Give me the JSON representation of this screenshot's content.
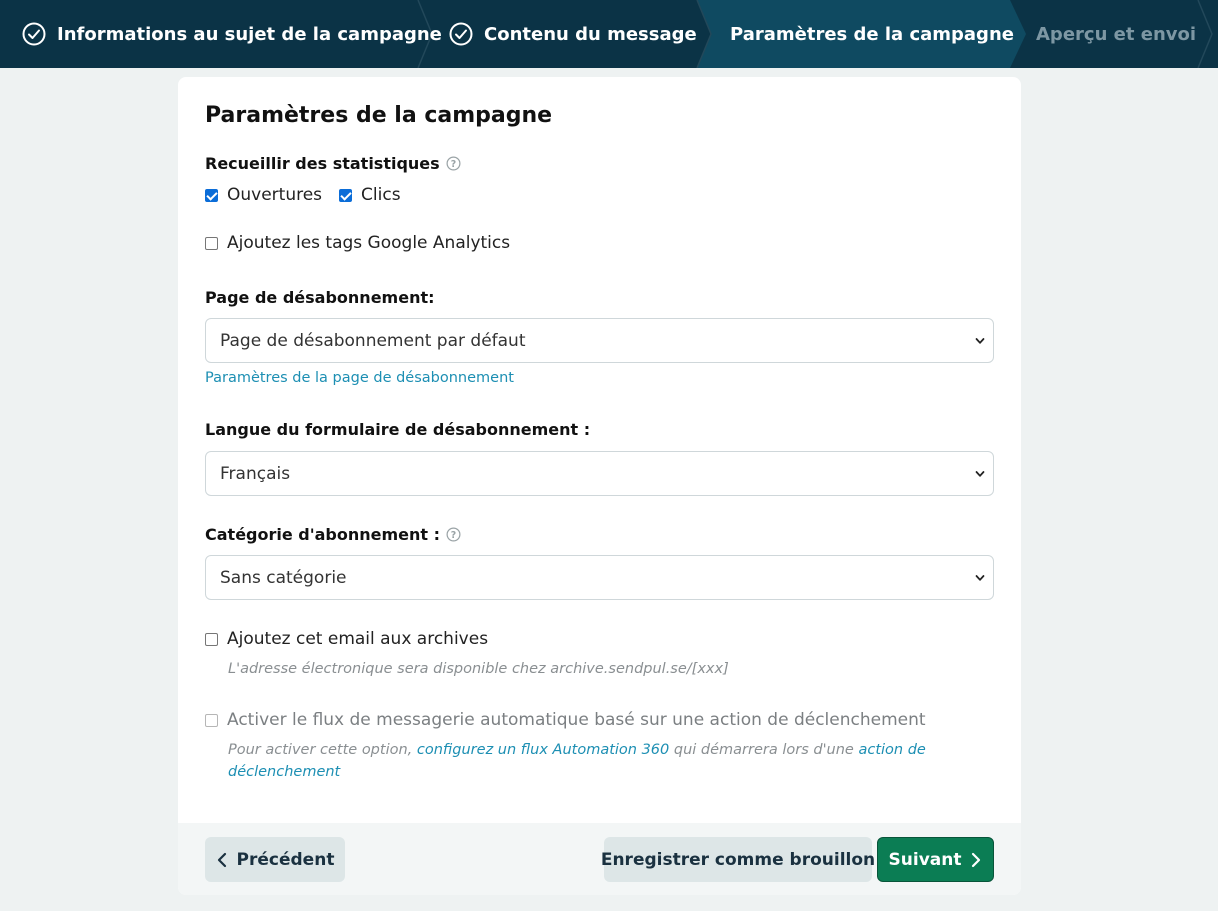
{
  "stepper": {
    "steps": [
      {
        "label": "Informations au sujet de la campagne",
        "state": "done"
      },
      {
        "label": "Contenu du message",
        "state": "done"
      },
      {
        "label": "Paramètres de la campagne",
        "state": "active"
      },
      {
        "label": "Aperçu et envoi",
        "state": "pending"
      }
    ]
  },
  "form": {
    "title": "Paramètres de la campagne",
    "stats": {
      "label": "Recueillir des statistiques",
      "opens_label": "Ouvertures",
      "opens_checked": true,
      "clicks_label": "Clics",
      "clicks_checked": true
    },
    "google_analytics": {
      "label": "Ajoutez les tags Google Analytics",
      "checked": false
    },
    "unsubscribe_page": {
      "label": "Page de désabonnement:",
      "value": "Page de désabonnement par défaut",
      "settings_link": "Paramètres de la page de désabonnement"
    },
    "unsubscribe_language": {
      "label": "Langue du formulaire de désabonnement :",
      "value": "Français"
    },
    "subscription_category": {
      "label": "Catégorie d'abonnement :",
      "value": "Sans catégorie"
    },
    "archive": {
      "label": "Ajoutez cet email aux archives",
      "checked": false,
      "hint": "L'adresse électronique sera disponible chez archive.sendpul.se/[xxx]"
    },
    "automation": {
      "label": "Activer le flux de messagerie automatique basé sur une action de déclenchement",
      "checked": false,
      "disabled": true,
      "hint_prefix": "Pour activer cette option, ",
      "hint_link1": "configurez un flux Automation 360",
      "hint_middle": " qui démarrera lors d'une ",
      "hint_link2": "action de déclenchement"
    }
  },
  "footer": {
    "prev_label": "Précédent",
    "draft_label": "Enregistrer comme brouillon",
    "next_label": "Suivant"
  },
  "colors": {
    "header_bg": "#0b3346",
    "active_step_bg": "#0f4a61",
    "link": "#1d8fb3",
    "primary_button": "#0b7d54",
    "checkbox_checked": "#0b6dd8"
  }
}
